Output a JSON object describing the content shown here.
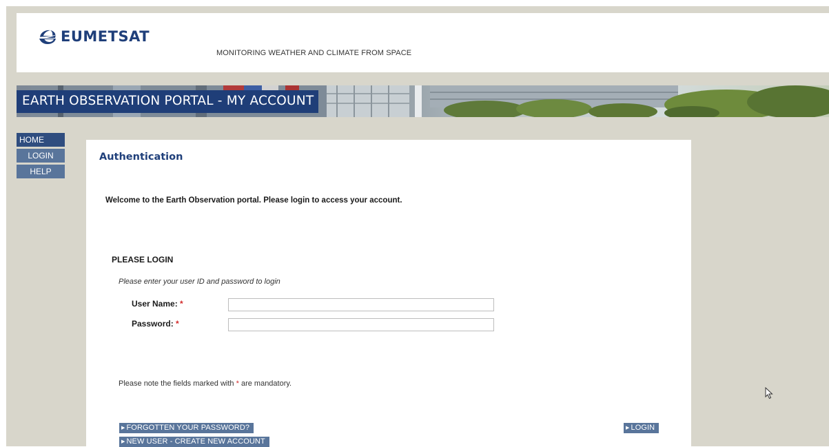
{
  "header": {
    "brand": "EUMETSAT",
    "tagline": "MONITORING WEATHER AND CLIMATE FROM SPACE"
  },
  "banner": {
    "title": "EARTH OBSERVATION PORTAL - MY ACCOUNT"
  },
  "nav": {
    "items": [
      {
        "label": "HOME"
      },
      {
        "label": "LOGIN"
      },
      {
        "label": "HELP"
      }
    ]
  },
  "content": {
    "title": "Authentication",
    "welcome": "Welcome to the Earth Observation portal. Please login to access your account.",
    "login_heading": "PLEASE LOGIN",
    "login_hint": "Please enter your user ID and password to login",
    "fields": {
      "username_label": "User Name:",
      "username_value": "",
      "password_label": "Password:",
      "password_value": "",
      "required_marker": "*"
    },
    "note_prefix": "Please note the fields marked with",
    "note_marker": "*",
    "note_suffix": "are mandatory.",
    "buttons": {
      "forgot": "FORGOTTEN YOUR PASSWORD?",
      "new_user": "NEW USER - CREATE NEW ACCOUNT",
      "login": "LOGIN"
    }
  },
  "colors": {
    "brand_blue": "#1f3f7a",
    "nav_blue": "#59759b",
    "nav_active": "#2f4d7f",
    "page_bg": "#d8d6cb",
    "required_red": "#d22a2a"
  },
  "icons": {
    "logo": "eumetsat-globe-icon",
    "button_arrow": "triangle-right-icon",
    "cursor": "mouse-pointer-icon"
  }
}
